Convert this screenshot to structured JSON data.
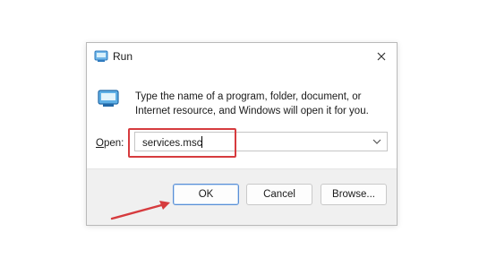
{
  "window": {
    "title": "Run",
    "title_icon": "run-icon",
    "close_icon": "close-icon"
  },
  "description": "Type the name of a program, folder, document, or Internet resource, and Windows will open it for you.",
  "open_field": {
    "label_prefix": "O",
    "label_rest": "pen:",
    "value": "services.msc",
    "dropdown_icon": "chevron-down-icon"
  },
  "buttons": {
    "ok": "OK",
    "cancel": "Cancel",
    "browse": "Browse..."
  },
  "annotation": {
    "highlight_color": "#d63b3e",
    "arrow_icon": "red-arrow-icon"
  },
  "colors": {
    "ok_border": "#5a8fd6",
    "footer_bg": "#f0f0f0"
  }
}
